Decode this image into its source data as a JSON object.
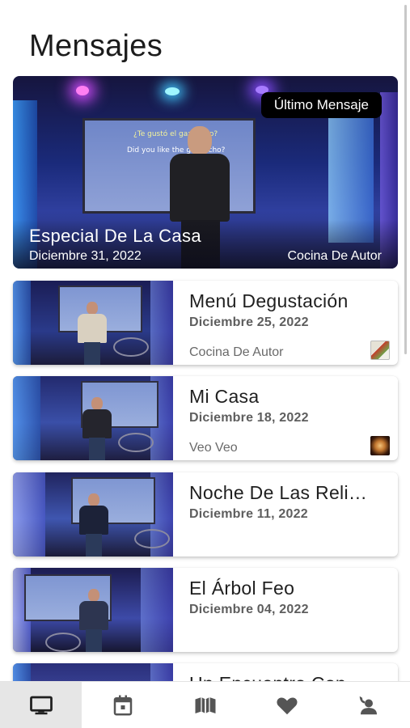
{
  "page": {
    "title": "Mensajes"
  },
  "featured": {
    "badge": "Último Mensaje",
    "title": "Especial De La Casa",
    "date": "Diciembre 31, 2022",
    "series": "Cocina De Autor",
    "slide_line1": "¿Te gustó el gazpacho?",
    "slide_line2": "Did you like the gazpacho?"
  },
  "messages": [
    {
      "title": "Menú Degustación",
      "date": "Diciembre 25, 2022",
      "series": "Cocina De Autor",
      "series_icon": "cocina-series-thumb"
    },
    {
      "title": "Mi Casa",
      "date": "Diciembre 18, 2022",
      "series": "Veo Veo",
      "series_icon": "veo-veo-series-thumb"
    },
    {
      "title": "Noche De Las Religiones",
      "date": "Diciembre 11, 2022",
      "series": "",
      "series_icon": ""
    },
    {
      "title": "El Árbol Feo",
      "date": "Diciembre 04, 2022",
      "series": "",
      "series_icon": ""
    },
    {
      "title": "Un Encuentro Con...",
      "date": "",
      "series": "",
      "series_icon": ""
    }
  ],
  "nav": {
    "items": [
      {
        "icon": "monitor-icon",
        "active": true
      },
      {
        "icon": "calendar-icon",
        "active": false
      },
      {
        "icon": "map-book-icon",
        "active": false
      },
      {
        "icon": "heart-icon",
        "active": false
      },
      {
        "icon": "contact-phone-icon",
        "active": false
      }
    ]
  },
  "colors": {
    "badge_bg": "#000000",
    "nav_active_bg": "#e6e6e6",
    "icon_color": "#555555"
  }
}
